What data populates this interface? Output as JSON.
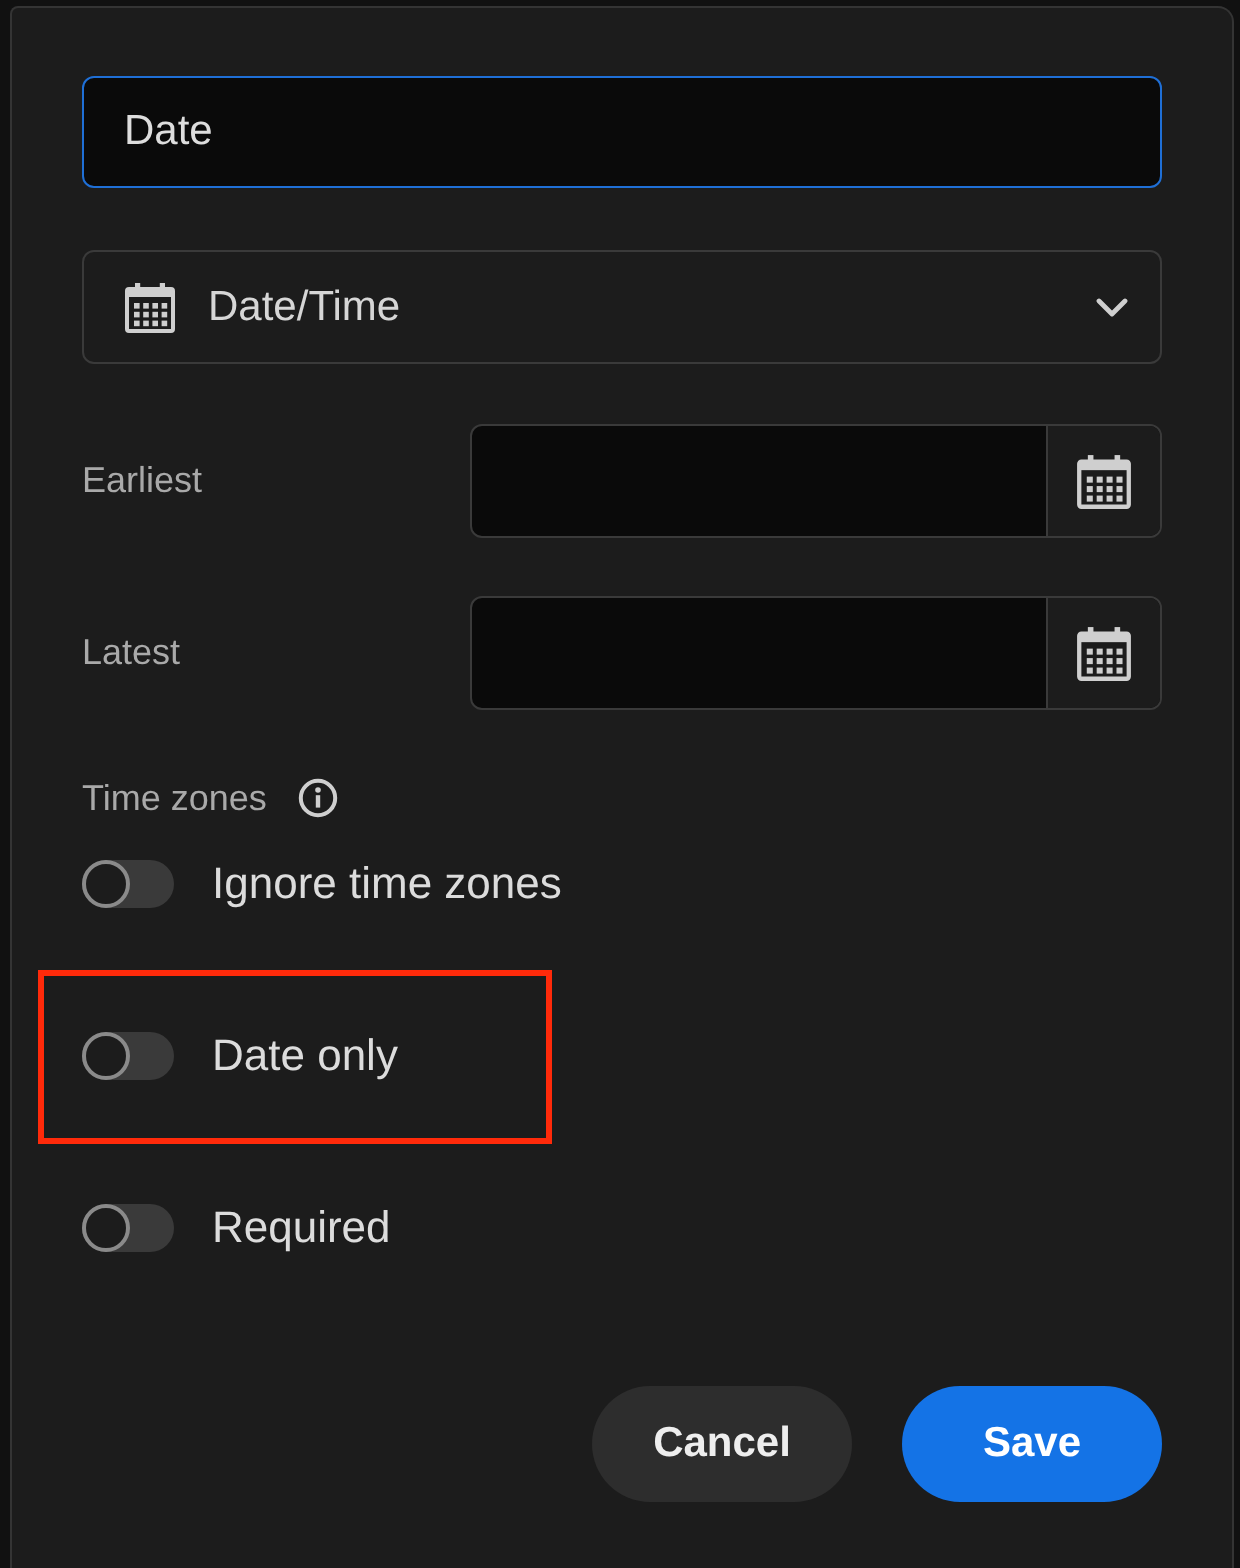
{
  "form": {
    "name_field": {
      "value": "Date",
      "focused": true
    },
    "type_select": {
      "value": "Date/Time"
    },
    "range_fields": [
      {
        "label": "Earliest"
      },
      {
        "label": "Latest"
      }
    ],
    "section_label": "Time zones",
    "toggles": [
      {
        "label": "Ignore time zones",
        "on": false,
        "highlighted": false
      },
      {
        "label": "Date only",
        "on": false,
        "highlighted": true
      },
      {
        "label": "Required",
        "on": false,
        "highlighted": false
      }
    ]
  },
  "buttons": [
    {
      "label": "Cancel",
      "kind": "secondary"
    },
    {
      "label": "Save",
      "kind": "primary"
    }
  ]
}
